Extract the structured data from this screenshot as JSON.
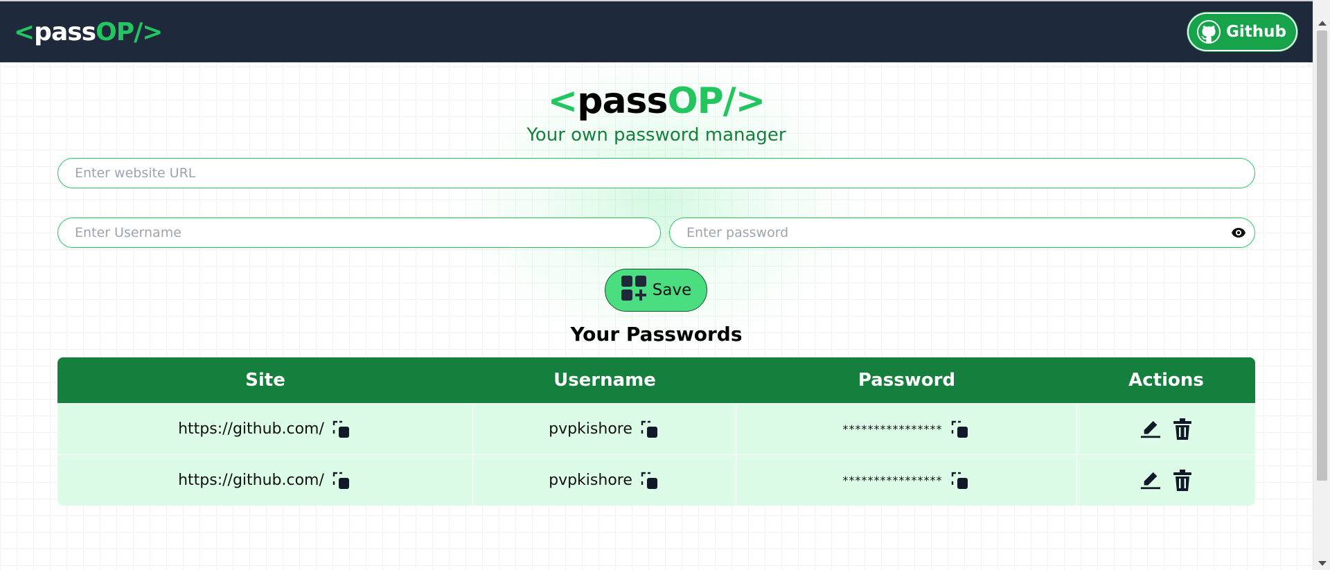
{
  "navbar": {
    "logo": {
      "open": "<",
      "part1": "pass",
      "part2": "OP/",
      "close": ">"
    },
    "github_label": "Github"
  },
  "header": {
    "title": {
      "open": "<",
      "part1": "pass",
      "part2": "OP/",
      "close": ">"
    },
    "subtitle": "Your own password manager"
  },
  "form": {
    "url_placeholder": "Enter website URL",
    "username_placeholder": "Enter Username",
    "password_placeholder": "Enter password",
    "save_label": "Save"
  },
  "passwords": {
    "title": "Your Passwords",
    "columns": [
      "Site",
      "Username",
      "Password",
      "Actions"
    ],
    "rows": [
      {
        "site": "https://github.com/",
        "username": "pvpkishore",
        "password": "****************"
      },
      {
        "site": "https://github.com/",
        "username": "pvpkishore",
        "password": "****************"
      }
    ]
  },
  "colors": {
    "navbar_bg": "#1e293b",
    "accent": "#22c55e",
    "table_header": "#15803d",
    "row_bg": "#dcfce7",
    "save_bg": "#4ade80"
  },
  "icons": [
    "github-icon",
    "eye-icon",
    "add-icon",
    "copy-icon",
    "edit-icon",
    "delete-icon"
  ]
}
